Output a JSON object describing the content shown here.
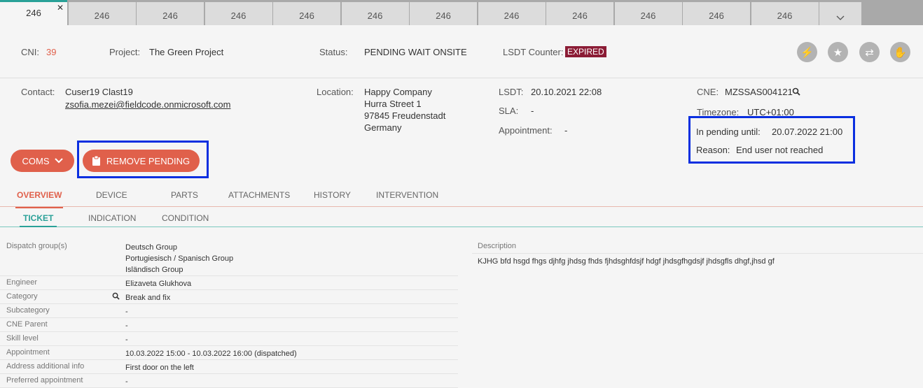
{
  "tabs": [
    "246",
    "246",
    "246",
    "246",
    "246",
    "246",
    "246",
    "246",
    "246",
    "246",
    "246",
    "246"
  ],
  "header": {
    "cni_label": "CNI:",
    "cni_value": "39",
    "project_label": "Project:",
    "project_value": "The Green Project",
    "status_label": "Status:",
    "status_value": "PENDING WAIT ONSITE",
    "lsdt_counter_label": "LSDT Counter:",
    "lsdt_counter_value": "EXPIRED"
  },
  "info": {
    "contact_label": "Contact:",
    "contact_name": "Cuser19 Clast19",
    "contact_email": "zsofia.mezei@fieldcode.onmicrosoft.com",
    "location_label": "Location:",
    "location_lines": [
      "Happy Company",
      "Hurra Street 1",
      "97845 Freudenstadt",
      "Germany"
    ],
    "lsdt_label": "LSDT:",
    "lsdt_value": "20.10.2021 22:08",
    "sla_label": "SLA:",
    "sla_value": "-",
    "appointment_label": "Appointment:",
    "appointment_value": "-",
    "cne_label": "CNE:",
    "cne_value": "MZSSAS004121",
    "timezone_label": "Timezone:",
    "timezone_value": "UTC+01:00",
    "pending_label": "In pending until:",
    "pending_value": "20.07.2022 21:00",
    "reason_label": "Reason:",
    "reason_value": "End user not reached"
  },
  "buttons": {
    "coms": "COMS",
    "remove_pending": "REMOVE PENDING"
  },
  "main_tabs": [
    "OVERVIEW",
    "DEVICE",
    "PARTS",
    "ATTACHMENTS",
    "HISTORY",
    "INTERVENTION"
  ],
  "sub_tabs": [
    "TICKET",
    "INDICATION",
    "CONDITION"
  ],
  "ticket": {
    "dispatch_label": "Dispatch group(s)",
    "dispatch_values": [
      "Deutsch Group",
      "Portugiesisch / Spanisch Group",
      "Isländisch Group"
    ],
    "rows": [
      {
        "label": "Engineer",
        "value": "Elizaveta Glukhova"
      },
      {
        "label": "Category",
        "value": "Break and fix"
      },
      {
        "label": "Subcategory",
        "value": "-"
      },
      {
        "label": "CNE Parent",
        "value": "-"
      },
      {
        "label": "Skill level",
        "value": "-"
      },
      {
        "label": "Appointment",
        "value": "10.03.2022 15:00 - 10.03.2022 16:00 (dispatched)"
      },
      {
        "label": "Address additional info",
        "value": "First door on the left"
      },
      {
        "label": "Preferred appointment",
        "value": "-"
      }
    ]
  },
  "description": {
    "label": "Description",
    "value": "KJHG bfd hsgd fhgs djhfg jhdsg fhds fjhdsghfdsjf hdgf jhdsgfhgdsjf jhdsgfls dhgf,jhsd gf"
  }
}
